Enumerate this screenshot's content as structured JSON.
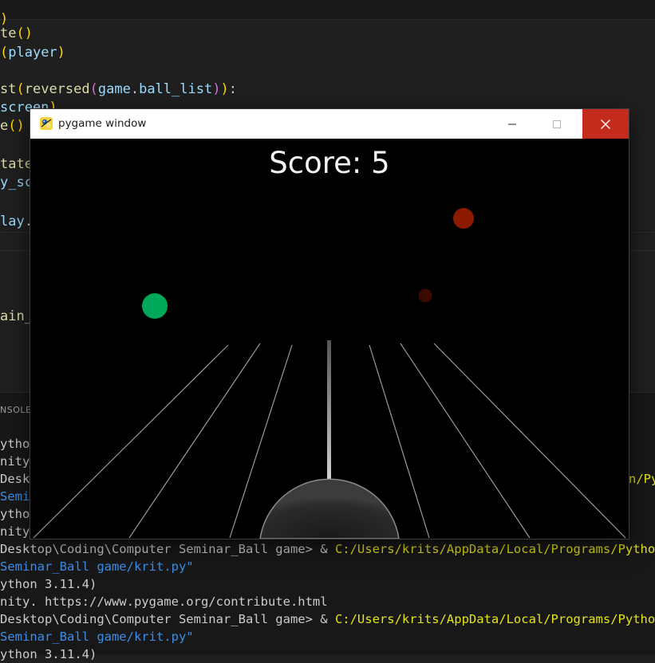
{
  "editor": {
    "lines": [
      {
        "a": "te",
        "b": "()"
      },
      {
        "a": "(player)"
      },
      {
        "a": ""
      },
      {
        "a": "st(reversed(game.ball_list)):"
      },
      {
        "a": "screen)"
      },
      {
        "a": "e()"
      },
      {
        "a": ""
      },
      {
        "a": "tate("
      },
      {
        "a": "y_sco"
      },
      {
        "a": ""
      },
      {
        "a": "lay.u"
      }
    ],
    "lower_text": "ain__"
  },
  "panel": {
    "tab_label": "NSOLE"
  },
  "terminal": {
    "lines": [
      {
        "text": "ython"
      },
      {
        "text": "nity."
      },
      {
        "text": "Deskt",
        "tail": "n/Py"
      },
      {
        "text": "Semin"
      },
      {
        "text": "ython"
      },
      {
        "text": "nity."
      },
      {
        "prompt": "Desktop\\Coding\\Computer Seminar_Ball game> & ",
        "path": "C:/Users/krits/AppData/Local/Programs/Python/Py"
      },
      {
        "script": "Seminar_Ball game/krit.py\""
      },
      {
        "text": "ython 3.11.4)"
      },
      {
        "text": "nity. https://www.pygame.org/contribute.html"
      },
      {
        "prompt": "Desktop\\Coding\\Computer Seminar_Ball game> & ",
        "path": "C:/Users/krits/AppData/Local/Programs/Python/Py"
      },
      {
        "script": "Seminar_Ball game/krit.py\""
      },
      {
        "text": "ython 3.11.4)"
      }
    ]
  },
  "window": {
    "title": "pygame window",
    "icon": "pygame-snake-icon",
    "controls": [
      "minimize-icon",
      "maximize-icon",
      "close-icon"
    ],
    "close_color": "#c42b1c"
  },
  "game": {
    "score_label": "Score: 5",
    "balls": [
      {
        "color": "#00a85a",
        "role": "player-ball"
      },
      {
        "color": "#8b1a00",
        "role": "enemy-ball"
      },
      {
        "color": "#3a0a00",
        "role": "enemy-ball-far"
      }
    ],
    "lane_color": "#bdbdbd",
    "paddle_color": "#3c3c3c"
  }
}
